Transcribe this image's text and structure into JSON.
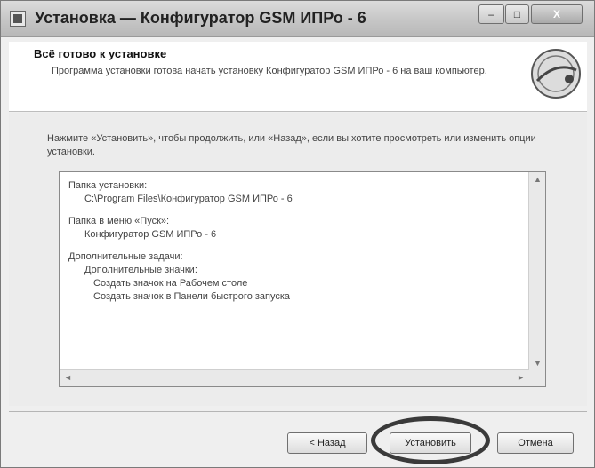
{
  "window": {
    "title": "Установка — Конфигуратор GSM ИПРо - 6",
    "controls": {
      "minimize": "–",
      "maximize": "□",
      "close": "X"
    }
  },
  "header": {
    "title": "Всё готово к установке",
    "subtitle": "Программа установки готова начать установку Конфигуратор GSM ИПРо - 6 на ваш компьютер.",
    "logo_icon": "gsm-logo-icon"
  },
  "instructions": "Нажмите «Установить», чтобы продолжить, или «Назад», если вы хотите просмотреть или изменить опции установки.",
  "memo": {
    "folder_label": "Папка установки:",
    "folder_value": "C:\\Program Files\\Конфигуратор GSM ИПРо - 6",
    "start_menu_label": "Папка в меню «Пуск»:",
    "start_menu_value": "Конфигуратор GSM ИПРо - 6",
    "tasks_label": "Дополнительные задачи:",
    "tasks_group": "Дополнительные значки:",
    "task_desktop": "Создать значок на Рабочем столе",
    "task_quicklaunch": "Создать значок в Панели быстрого запуска"
  },
  "buttons": {
    "back": "< Назад",
    "install": "Установить",
    "cancel": "Отмена"
  }
}
